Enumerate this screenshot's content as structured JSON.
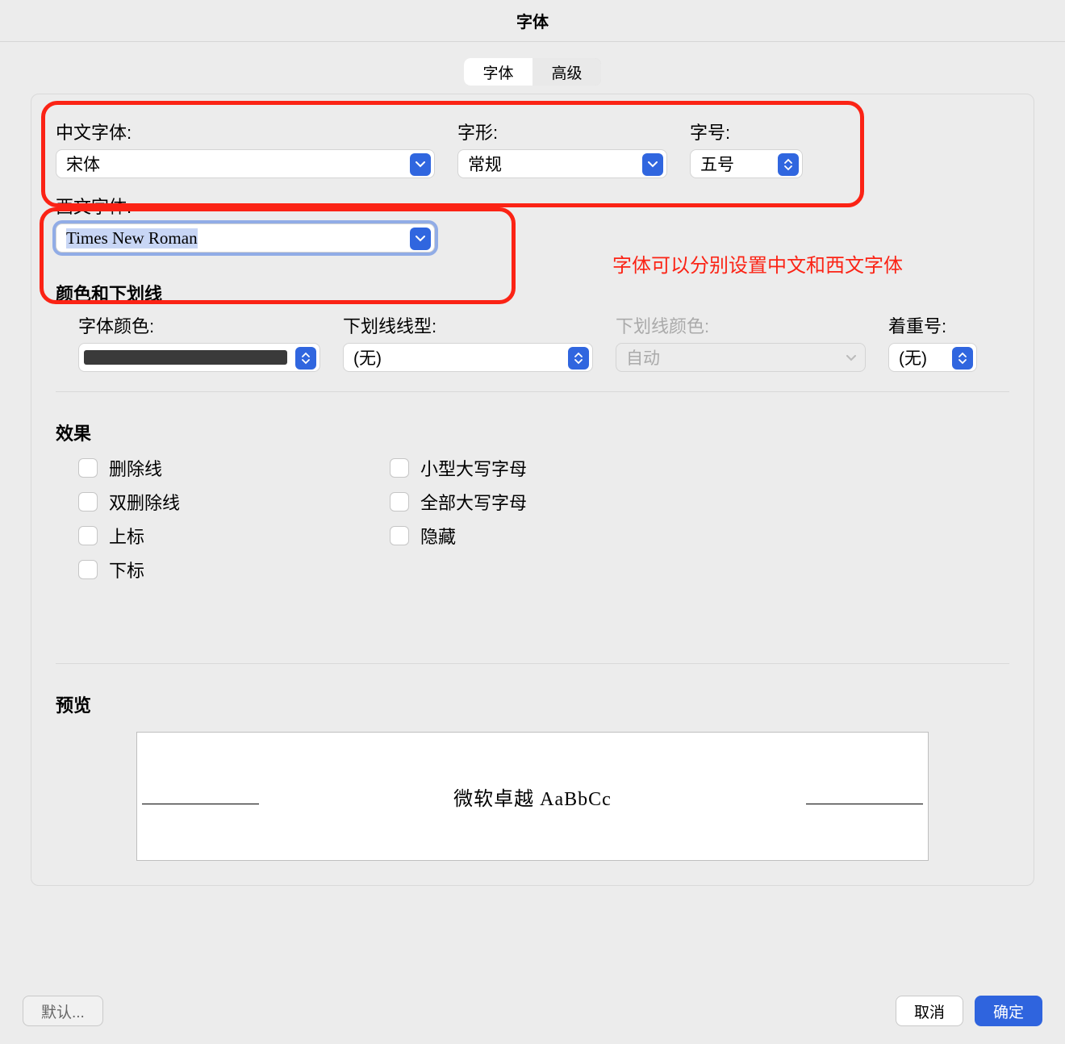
{
  "window": {
    "title": "字体"
  },
  "tabs": {
    "font": "字体",
    "advanced": "高级"
  },
  "labels": {
    "chinese_font": "中文字体:",
    "font_style": "字形:",
    "font_size": "字号:",
    "western_font": "西文字体:",
    "color_underline_header": "颜色和下划线",
    "font_color": "字体颜色:",
    "underline_style": "下划线线型:",
    "underline_color": "下划线颜色:",
    "emphasis_mark": "着重号:",
    "effects_header": "效果",
    "preview_header": "预览"
  },
  "values": {
    "chinese_font": "宋体",
    "font_style": "常规",
    "font_size": "五号",
    "western_font": "Times New Roman",
    "underline_style": "(无)",
    "underline_color": "自动",
    "emphasis_mark": "(无)",
    "font_color": "#3a3a3a"
  },
  "effects": {
    "left": [
      "删除线",
      "双删除线",
      "上标",
      "下标"
    ],
    "right": [
      "小型大写字母",
      "全部大写字母",
      "隐藏"
    ]
  },
  "preview": {
    "text": "微软卓越  AaBbCc"
  },
  "buttons": {
    "default": "默认...",
    "cancel": "取消",
    "ok": "确定"
  },
  "annotation": "字体可以分别设置中文和西文字体"
}
